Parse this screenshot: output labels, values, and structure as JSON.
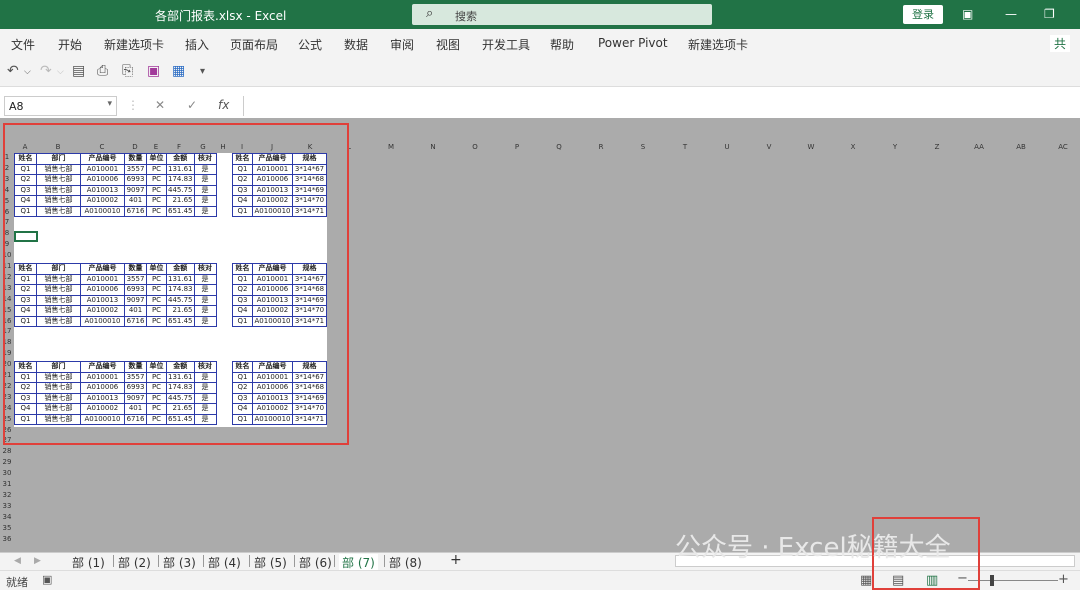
{
  "window": {
    "title": "各部门报表.xlsx  -  Excel",
    "search_placeholder": "搜索",
    "login_label": "登录"
  },
  "menu": {
    "items": [
      "文件",
      "开始",
      "新建选项卡",
      "插入",
      "页面布局",
      "公式",
      "数据",
      "审阅",
      "视图",
      "开发工具",
      "帮助",
      "Power Pivot",
      "新建选项卡"
    ],
    "share_label": "共"
  },
  "formula_bar": {
    "name_box": "A8",
    "cancel": "✕",
    "enter": "✓",
    "fx": "fx"
  },
  "columns": [
    "A",
    "B",
    "C",
    "D",
    "E",
    "F",
    "G",
    "H",
    "I",
    "J",
    "K",
    "L",
    "M",
    "N",
    "O",
    "P",
    "Q",
    "R",
    "S",
    "T",
    "U",
    "V",
    "W",
    "X",
    "Y",
    "Z",
    "AA",
    "AB",
    "AC"
  ],
  "rows": [
    "1",
    "2",
    "3",
    "4",
    "5",
    "6",
    "7",
    "8",
    "9",
    "10",
    "11",
    "12",
    "13",
    "14",
    "15",
    "16",
    "17",
    "18",
    "19",
    "20",
    "21",
    "22",
    "23",
    "24",
    "25",
    "26",
    "27",
    "28",
    "29",
    "30",
    "31",
    "32",
    "33",
    "34",
    "35",
    "36"
  ],
  "table_left": {
    "headers": [
      "姓名",
      "部门",
      "产品编号",
      "数量",
      "单位",
      "金额",
      "核对"
    ],
    "rows": [
      [
        "Q1",
        "销售七部",
        "A010001",
        "3557",
        "PC",
        "131.61",
        "是"
      ],
      [
        "Q2",
        "销售七部",
        "A010006",
        "6993",
        "PC",
        "174.83",
        "是"
      ],
      [
        "Q3",
        "销售七部",
        "A010013",
        "9097",
        "PC",
        "445.75",
        "是"
      ],
      [
        "Q4",
        "销售七部",
        "A010002",
        "401",
        "PC",
        "21.65",
        "是"
      ],
      [
        "Q1",
        "销售七部",
        "A0100010",
        "6716",
        "PC",
        "651.45",
        "是"
      ]
    ]
  },
  "table_right": {
    "headers": [
      "姓名",
      "产品编号",
      "规格"
    ],
    "rows": [
      [
        "Q1",
        "A010001",
        "3*14*67"
      ],
      [
        "Q2",
        "A010006",
        "3*14*68"
      ],
      [
        "Q3",
        "A010013",
        "3*14*69"
      ],
      [
        "Q4",
        "A010002",
        "3*14*70"
      ],
      [
        "Q1",
        "A0100010",
        "3*14*71"
      ]
    ]
  },
  "sheets": {
    "tabs": [
      "部 (1)",
      "部 (2)",
      "部 (3)",
      "部 (4)",
      "部 (5)",
      "部 (6)",
      "部 (7)",
      "部 (8)"
    ],
    "active_index": 6,
    "add_label": "+"
  },
  "status": {
    "ready": "就绪"
  },
  "watermark": "公众号 · Excel秘籍大全"
}
